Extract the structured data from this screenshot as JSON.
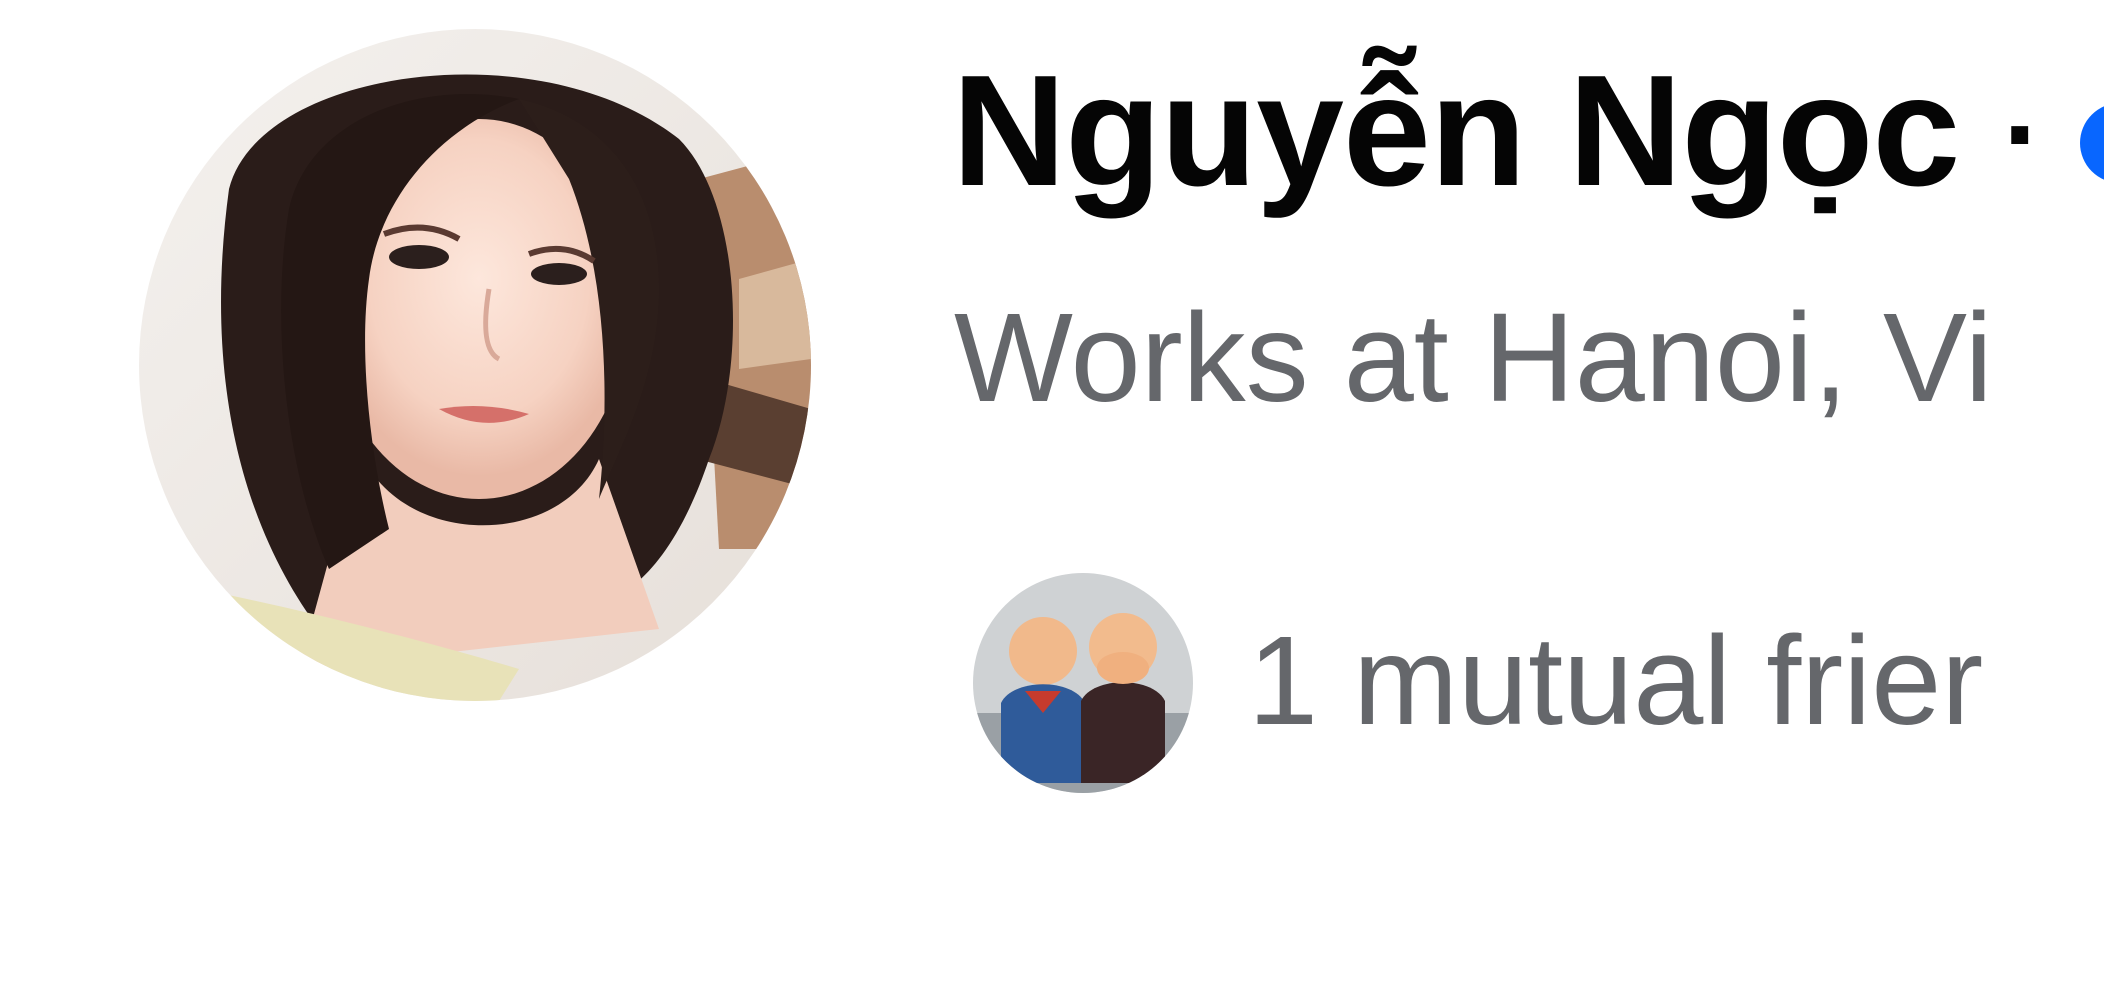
{
  "profile": {
    "name": "Nguyễn Ngọc",
    "separator": "·",
    "subtitle": "Works at Hanoi, Vi",
    "mutual_friends_text": "1 mutual frier"
  },
  "icons": {
    "avatar": "profile-photo",
    "verified": "verified-badge-icon",
    "mutual_avatar": "mutual-friend-photo"
  },
  "colors": {
    "name": "#050505",
    "secondary_text": "#65676b",
    "accent": "#0866ff",
    "background": "#ffffff"
  }
}
